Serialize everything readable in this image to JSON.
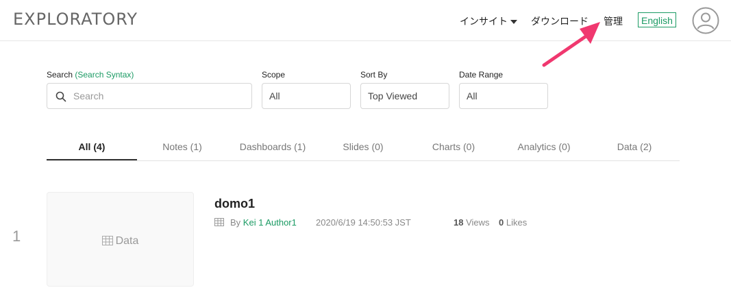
{
  "header": {
    "logo": "EXPLORATORY",
    "nav": {
      "insight": "インサイト",
      "download": "ダウンロード",
      "admin": "管理"
    },
    "language_button": "English"
  },
  "filters": {
    "search": {
      "label": "Search",
      "syntax_link": "(Search Syntax)",
      "placeholder": "Search"
    },
    "scope": {
      "label": "Scope",
      "value": "All"
    },
    "sort_by": {
      "label": "Sort By",
      "value": "Top Viewed"
    },
    "date_range": {
      "label": "Date Range",
      "value": "All"
    }
  },
  "tabs": [
    {
      "label": "All (4)",
      "active": true
    },
    {
      "label": "Notes (1)"
    },
    {
      "label": "Dashboards (1)"
    },
    {
      "label": "Slides (0)"
    },
    {
      "label": "Charts (0)"
    },
    {
      "label": "Analytics (0)"
    },
    {
      "label": "Data (2)"
    }
  ],
  "results": [
    {
      "rank": "1",
      "thumbnail_label": "Data",
      "title": "domo1",
      "by": "By",
      "author": "Kei 1 Author1",
      "timestamp": "2020/6/19 14:50:53 JST",
      "views_count": "18",
      "views_label": "Views",
      "likes_count": "0",
      "likes_label": "Likes"
    }
  ],
  "colors": {
    "accent": "#1a9a63",
    "annotation_arrow": "#f0386f"
  }
}
